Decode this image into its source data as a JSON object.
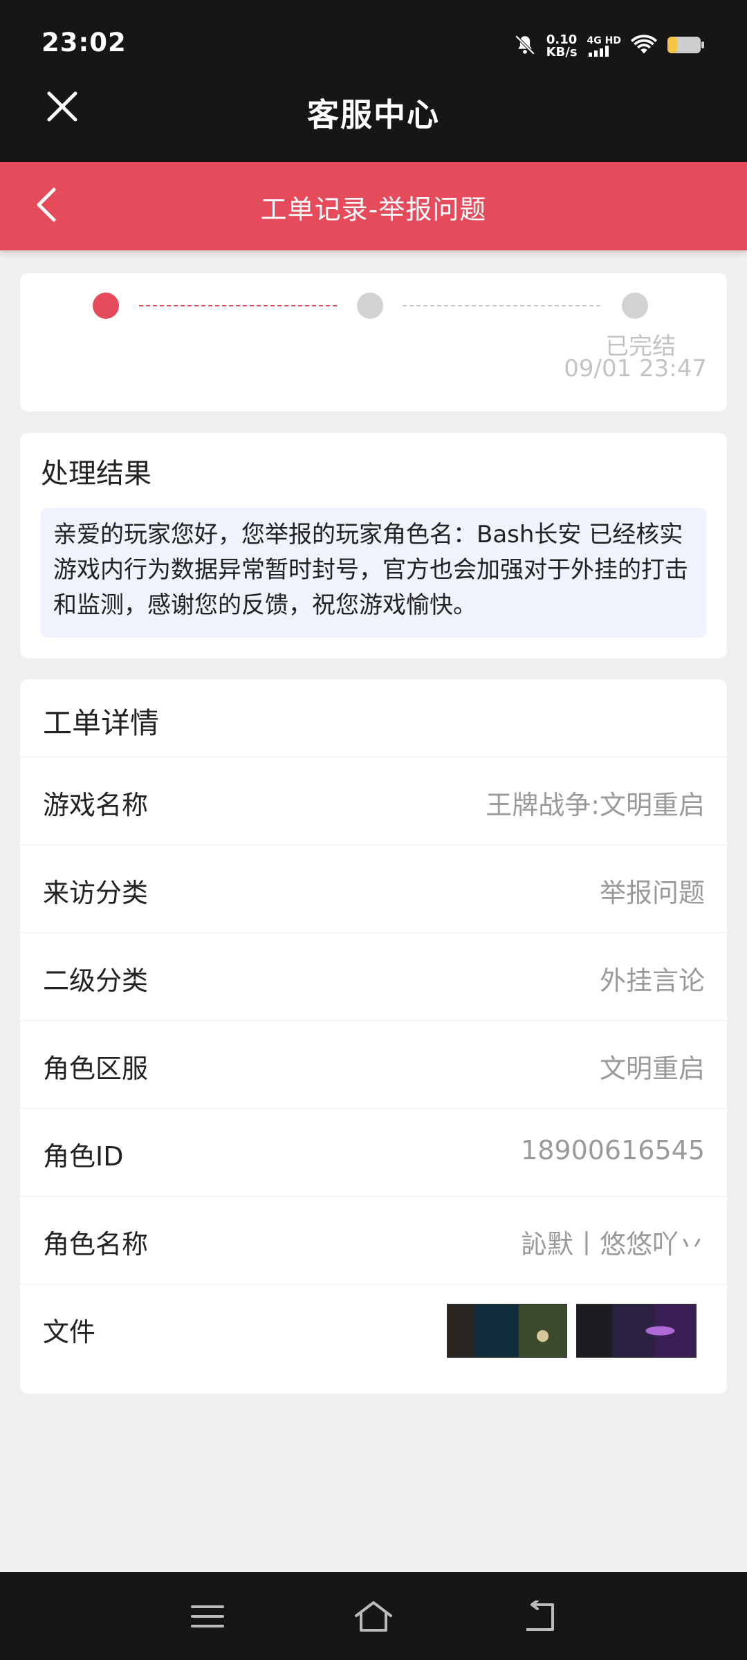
{
  "status_bar": {
    "time": "23:02",
    "net_speed_value": "0.10",
    "net_speed_unit": "KB/s",
    "network_type": "4G HD",
    "icons": [
      "mute-icon",
      "signal-icon",
      "wifi-icon",
      "battery-icon"
    ]
  },
  "top_bar": {
    "title": "客服中心",
    "close_icon": "close-icon"
  },
  "header": {
    "title": "工单记录-举报问题",
    "back_icon": "chevron-left-icon",
    "color": "#e64b5b"
  },
  "progress": {
    "steps": 3,
    "current_step": 1,
    "final_label": "已完结",
    "final_time": "09/01 23:47"
  },
  "result": {
    "title": "处理结果",
    "text": "亲爱的玩家您好，您举报的玩家角色名：Bash长安 已经核实游戏内行为数据异常暂时封号，官方也会加强对于外挂的打击和监测，感谢您的反馈，祝您游戏愉快。"
  },
  "details": {
    "title": "工单详情",
    "rows": [
      {
        "label": "游戏名称",
        "value": "王牌战争:文明重启"
      },
      {
        "label": "来访分类",
        "value": "举报问题"
      },
      {
        "label": "二级分类",
        "value": "外挂言论"
      },
      {
        "label": "角色区服",
        "value": "文明重启"
      },
      {
        "label": "角色ID",
        "value": "18900616545"
      },
      {
        "label": "角色名称",
        "value": "訫默丨悠悠吖丷"
      }
    ],
    "file_label": "文件",
    "file_count": 2
  },
  "nav_bar": {
    "icons": [
      "menu-icon",
      "home-icon",
      "back-icon"
    ]
  }
}
